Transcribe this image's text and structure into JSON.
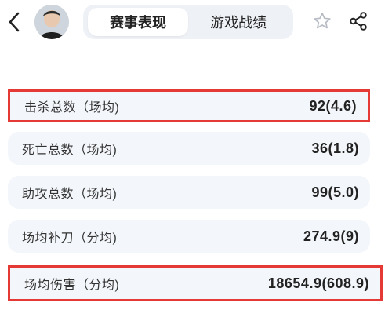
{
  "header": {
    "tabs": [
      {
        "label": "赛事表现",
        "active": true
      },
      {
        "label": "游戏战绩",
        "active": false
      }
    ],
    "icons": {
      "back": "chevron-left-icon",
      "favorite": "star-outline-icon",
      "share": "share-icon"
    }
  },
  "stats": [
    {
      "label": "击杀总数（场均)",
      "value": "92(4.6)",
      "highlighted": true
    },
    {
      "label": "死亡总数（场均)",
      "value": "36(1.8)",
      "highlighted": false
    },
    {
      "label": "助攻总数（场均)",
      "value": "99(5.0)",
      "highlighted": false
    },
    {
      "label": "场均补刀（分均)",
      "value": "274.9(9)",
      "highlighted": false
    },
    {
      "label": "场均伤害（分均)",
      "value": "18654.9(608.9)",
      "highlighted": true
    }
  ],
  "colors": {
    "highlight_border": "#e53935",
    "row_background": "#f3f6fa",
    "tab_bar_background": "#eef1f6"
  }
}
